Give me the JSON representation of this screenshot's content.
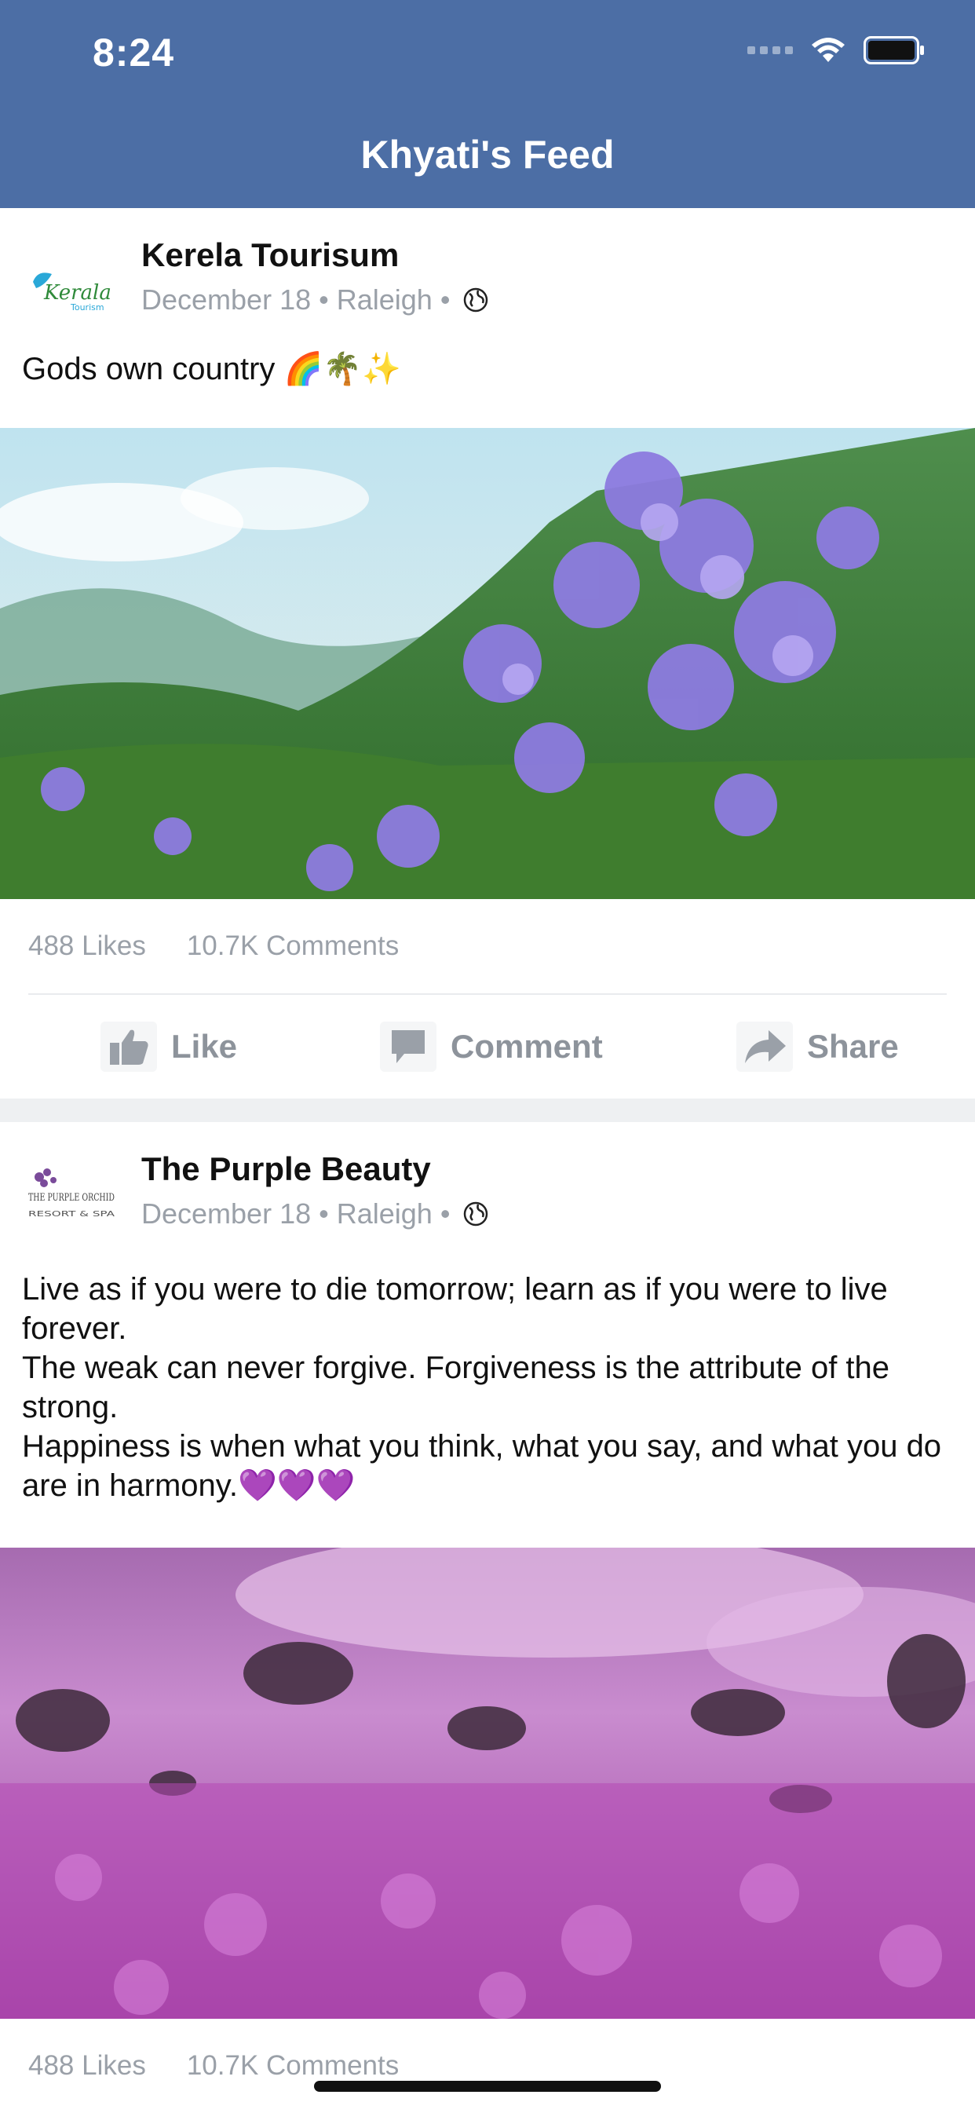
{
  "status_bar": {
    "time": "8:24"
  },
  "nav": {
    "title": "Khyati's Feed"
  },
  "colors": {
    "nav_bg": "#4c6ea5",
    "muted_text": "#9aa0a8",
    "separator": "#eef0f2"
  },
  "posts": [
    {
      "author": "Kerela Tourisum",
      "avatar_text": "Kerala",
      "avatar_sub": "Tourism",
      "date": "December 18",
      "location": "Raleigh",
      "dot": "•",
      "text_lines": [
        "Gods own country 🌈🌴✨"
      ],
      "image_desc_icon": "mountain-flowers-image",
      "likes": "488 Likes",
      "comments": "10.7K Comments",
      "actions": {
        "like": "Like",
        "comment": "Comment",
        "share": "Share"
      }
    },
    {
      "author": "The Purple Beauty",
      "avatar_text": "THE PURPLE ORCHID",
      "avatar_sub": "RESORT & SPA",
      "date": "December 18",
      "location": "Raleigh",
      "dot": "•",
      "text_lines": [
        "Live as if you were to die tomorrow; learn as if you were to live forever.",
        "The weak can never forgive. Forgiveness is the attribute of the strong.",
        "Happiness is when what you think, what you say, and what you do are in harmony.💜💜💜"
      ],
      "image_desc_icon": "purple-meadow-image",
      "likes": "488 Likes",
      "comments": "10.7K Comments"
    }
  ]
}
